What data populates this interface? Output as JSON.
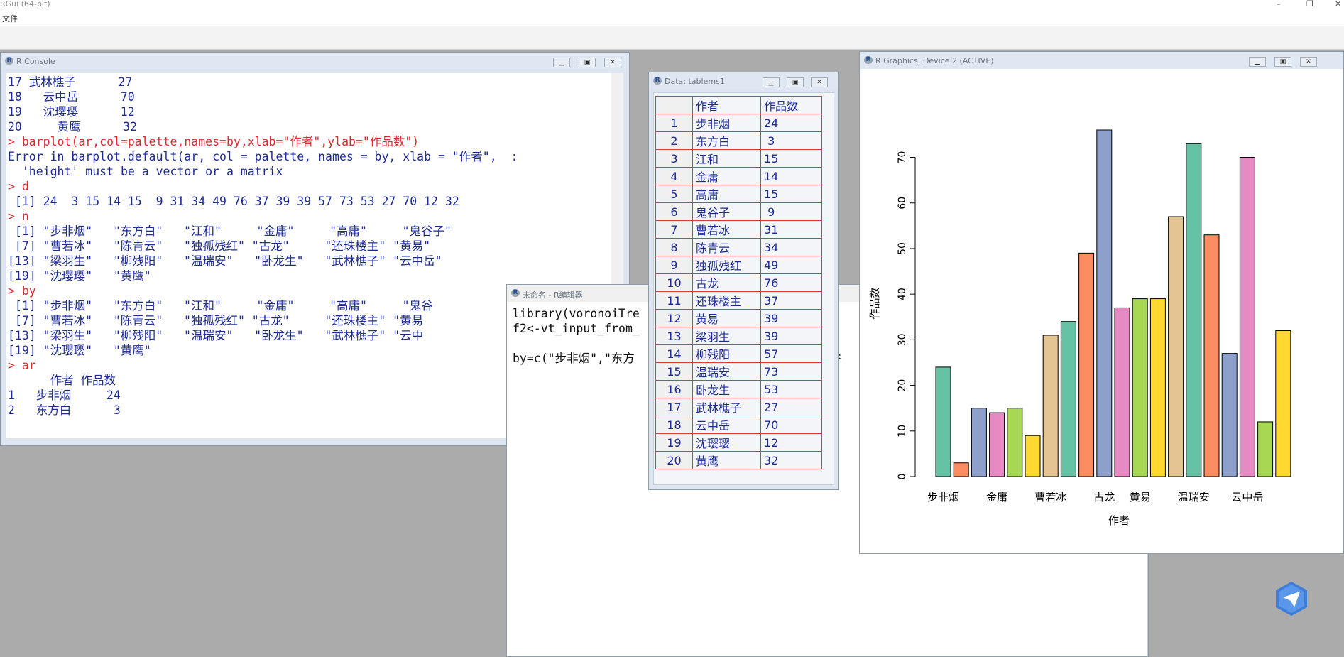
{
  "app": {
    "title": "RGui (64-bit)",
    "menu_file": "文件",
    "win_minimize": "–",
    "win_restore": "❐",
    "win_close": "✕"
  },
  "console": {
    "title": "R Console",
    "lines": [
      {
        "text": "17 武林樵子      27",
        "color": "blue"
      },
      {
        "text": "18   云中岳      70",
        "color": "blue"
      },
      {
        "text": "19   沈璎璎      12",
        "color": "blue"
      },
      {
        "text": "20     黄鹰      32",
        "color": "blue"
      },
      {
        "text": "> barplot(ar,col=palette,names=by,xlab=\"作者\",ylab=\"作品数\")",
        "color": "red"
      },
      {
        "text": "Error in barplot.default(ar, col = palette, names = by, xlab = \"作者\",  :",
        "color": "blue"
      },
      {
        "text": "  'height' must be a vector or a matrix",
        "color": "blue"
      },
      {
        "text": "> d",
        "color": "red"
      },
      {
        "text": " [1] 24  3 15 14 15  9 31 34 49 76 37 39 39 57 73 53 27 70 12 32",
        "color": "blue"
      },
      {
        "text": "> n",
        "color": "red"
      },
      {
        "text": " [1] \"步非烟\"   \"东方白\"   \"江和\"     \"金庸\"     \"高庸\"     \"鬼谷子\"",
        "color": "blue"
      },
      {
        "text": " [7] \"曹若冰\"   \"陈青云\"   \"独孤残红\" \"古龙\"     \"还珠楼主\" \"黄易\"",
        "color": "blue"
      },
      {
        "text": "[13] \"梁羽生\"   \"柳残阳\"   \"温瑞安\"   \"卧龙生\"   \"武林樵子\" \"云中岳\"",
        "color": "blue"
      },
      {
        "text": "[19] \"沈璎璎\"   \"黄鹰\"",
        "color": "blue"
      },
      {
        "text": "> by",
        "color": "red"
      },
      {
        "text": " [1] \"步非烟\"   \"东方白\"   \"江和\"     \"金庸\"     \"高庸\"     \"鬼谷",
        "color": "blue"
      },
      {
        "text": " [7] \"曹若冰\"   \"陈青云\"   \"独孤残红\" \"古龙\"     \"还珠楼主\" \"黄易",
        "color": "blue"
      },
      {
        "text": "[13] \"梁羽生\"   \"柳残阳\"   \"温瑞安\"   \"卧龙生\"   \"武林樵子\" \"云中",
        "color": "blue"
      },
      {
        "text": "[19] \"沈璎璎\"   \"黄鹰\"",
        "color": "blue"
      },
      {
        "text": "> ar",
        "color": "red"
      },
      {
        "text": "      作者 作品数",
        "color": "blue"
      },
      {
        "text": "1   步非烟     24",
        "color": "blue"
      },
      {
        "text": "2   东方白      3",
        "color": "blue"
      }
    ]
  },
  "editor": {
    "title": "未命名 - R编辑器",
    "lines": [
      "library(voronoiTre",
      "f2<-vt_input_from_",
      "",
      "by=c(\"步非烟\",\"东方                          鬼谷"
    ]
  },
  "dataview": {
    "title": "Data: tablems1",
    "headers": [
      "作者",
      "作品数"
    ],
    "rows": [
      {
        "n": "1",
        "name": "步非烟",
        "count": "24"
      },
      {
        "n": "2",
        "name": "东方白",
        "count": " 3"
      },
      {
        "n": "3",
        "name": "江和",
        "count": "15"
      },
      {
        "n": "4",
        "name": "金庸",
        "count": "14"
      },
      {
        "n": "5",
        "name": "高庸",
        "count": "15"
      },
      {
        "n": "6",
        "name": "鬼谷子",
        "count": " 9"
      },
      {
        "n": "7",
        "name": "曹若冰",
        "count": "31"
      },
      {
        "n": "8",
        "name": "陈青云",
        "count": "34"
      },
      {
        "n": "9",
        "name": "独孤残红",
        "count": "49"
      },
      {
        "n": "10",
        "name": "古龙",
        "count": "76"
      },
      {
        "n": "11",
        "name": "还珠楼主",
        "count": "37"
      },
      {
        "n": "12",
        "name": "黄易",
        "count": "39"
      },
      {
        "n": "13",
        "name": "梁羽生",
        "count": "39"
      },
      {
        "n": "14",
        "name": "柳残阳",
        "count": "57"
      },
      {
        "n": "15",
        "name": "温瑞安",
        "count": "73"
      },
      {
        "n": "16",
        "name": "卧龙生",
        "count": "53"
      },
      {
        "n": "17",
        "name": "武林樵子",
        "count": "27"
      },
      {
        "n": "18",
        "name": "云中岳",
        "count": "70"
      },
      {
        "n": "19",
        "name": "沈璎璎",
        "count": "12"
      },
      {
        "n": "20",
        "name": "黄鹰",
        "count": "32"
      }
    ]
  },
  "graphics": {
    "title": "R Graphics: Device 2 (ACTIVE)"
  },
  "colors": {
    "console_blue": "#1d2b95",
    "console_red": "#e0282f"
  },
  "chart_data": {
    "type": "bar",
    "xlabel": "作者",
    "ylabel": "作品数",
    "ylim": [
      0,
      76
    ],
    "yticks": [
      0,
      10,
      20,
      30,
      40,
      50,
      60,
      70
    ],
    "categories": [
      "步非烟",
      "东方白",
      "江和",
      "金庸",
      "高庸",
      "鬼谷子",
      "曹若冰",
      "陈青云",
      "独孤残红",
      "古龙",
      "还珠楼主",
      "黄易",
      "梁羽生",
      "柳残阳",
      "温瑞安",
      "卧龙生",
      "武林樵子",
      "云中岳",
      "沈璎璎",
      "黄鹰"
    ],
    "values": [
      24,
      3,
      15,
      14,
      15,
      9,
      31,
      34,
      49,
      76,
      37,
      39,
      39,
      57,
      73,
      53,
      27,
      70,
      12,
      32
    ],
    "shown_category_labels": [
      "步非烟",
      "金庸",
      "曹若冰",
      "古龙",
      "黄易",
      "温瑞安",
      "云中岳"
    ],
    "bar_colors": [
      "#66c2a5",
      "#fc8d62",
      "#8da0cb",
      "#e78ac3",
      "#a6d854",
      "#ffd92f",
      "#e5c494",
      "#66c2a5",
      "#fc8d62",
      "#8da0cb",
      "#e78ac3",
      "#a6d854",
      "#ffd92f",
      "#e5c494",
      "#66c2a5",
      "#fc8d62",
      "#8da0cb",
      "#e78ac3",
      "#a6d854",
      "#ffd92f"
    ]
  }
}
